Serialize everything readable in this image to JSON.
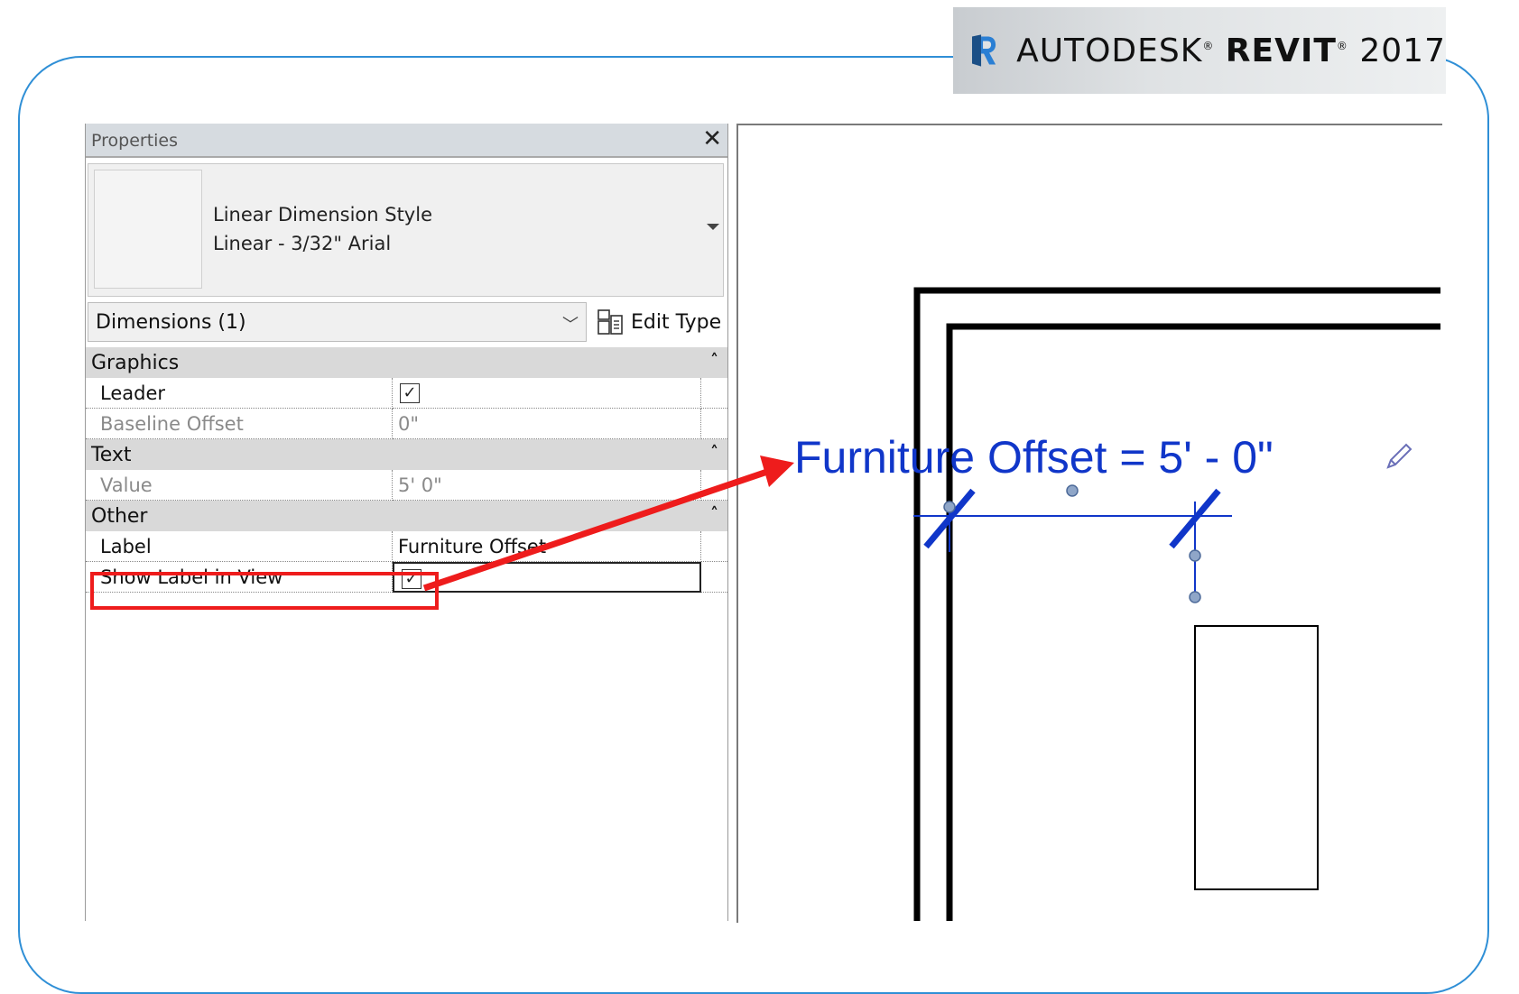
{
  "brand": {
    "logo_letter": "R",
    "name": "AUTODESK",
    "product": "REVIT",
    "year": "2017",
    "registered_mark": "®"
  },
  "properties_panel": {
    "title": "Properties",
    "close_icon": "close-icon",
    "type_selector": {
      "family": "Linear Dimension Style",
      "type": "Linear - 3/32\" Arial"
    },
    "instance_filter": "Dimensions (1)",
    "edit_type_label": "Edit Type",
    "sections": [
      {
        "name": "Graphics",
        "rows": [
          {
            "label": "Leader",
            "value": "",
            "kind": "checkbox",
            "checked": true
          },
          {
            "label": "Baseline Offset",
            "value": "0\"",
            "kind": "text",
            "disabled": true
          }
        ]
      },
      {
        "name": "Text",
        "rows": [
          {
            "label": "Value",
            "value": "5'  0\"",
            "kind": "text",
            "disabled": true
          }
        ]
      },
      {
        "name": "Other",
        "rows": [
          {
            "label": "Label",
            "value": "Furniture Offset",
            "kind": "text"
          },
          {
            "label": "Show Label in View",
            "value": "",
            "kind": "checkbox",
            "checked": true
          }
        ]
      }
    ],
    "collapse_glyph": "»"
  },
  "drawing_view": {
    "dimension_label": "Furniture Offset = 5' - 0\"",
    "edit_icon": "pencil-icon"
  },
  "annotation": {
    "highlight_color": "#ee1c1c",
    "arrow_color": "#ee1c1c"
  },
  "colors": {
    "frame": "#2f8fd6",
    "dimension_blue": "#1036c9"
  }
}
